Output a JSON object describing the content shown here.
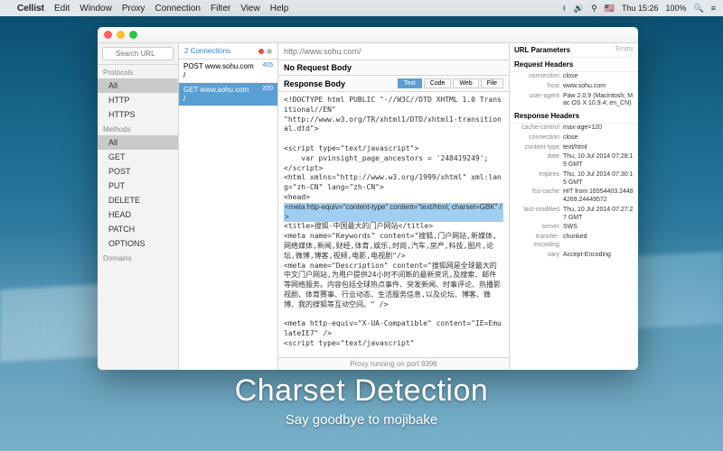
{
  "menubar": {
    "app": "Cellist",
    "items": [
      "Edit",
      "Window",
      "Proxy",
      "Connection",
      "Filter",
      "View",
      "Help"
    ],
    "clock": "Thu 15:26",
    "battery": "100%",
    "flag": "🇺🇸"
  },
  "sidebar": {
    "search_placeholder": "Search URL",
    "sections": {
      "protocols": {
        "label": "Protocols",
        "items": [
          "All",
          "HTTP",
          "HTTPS"
        ],
        "selected": 0
      },
      "methods": {
        "label": "Methods",
        "items": [
          "All",
          "GET",
          "POST",
          "PUT",
          "DELETE",
          "HEAD",
          "PATCH",
          "OPTIONS"
        ],
        "selected": 0
      },
      "domains": {
        "label": "Domains"
      }
    }
  },
  "connections": {
    "title": "2 Connections",
    "rows": [
      {
        "method": "POST",
        "host": "www.sohu.com",
        "path": "/",
        "status": "405",
        "selected": false
      },
      {
        "method": "GET",
        "host": "www.sohu.com",
        "path": "/",
        "status": "200",
        "selected": true
      }
    ]
  },
  "detail": {
    "url": "http://www.sohu.com/",
    "no_request_body": "No Request Body",
    "response_body": "Response Body",
    "tabs": [
      "Text",
      "Code",
      "Web",
      "File"
    ],
    "selected_tab": 0,
    "html_lines": [
      "<!DOCTYPE html PUBLIC \"-//W3C//DTD XHTML 1.0 Transitional//EN\"",
      "\"http://www.w3.org/TR/xhtml1/DTD/xhtml1-transitional.dtd\">",
      "",
      "<script type=\"text/javascript\">",
      "    var pvinsight_page_ancestors = '248419249';",
      "</​script>",
      "<html xmlns=\"http://www.w3.org/1999/xhtml\" xml:lang=\"zh-CN\" lang=\"zh-CN\">",
      "<head>"
    ],
    "html_highlight": "<meta http-equiv=\"content-type\" content=\"text/html; charset=GBK\" />",
    "html_after": [
      "<title>搜狐-中国最大的门户网站</title>",
      "<meta name=\"Keywords\" content=\"搜狐,门户网站,新媒体,网络媒体,新闻,财经,体育,娱乐,时尚,汽车,房产,科技,图片,论坛,微博,博客,视频,电影,电视剧\"/>",
      "<meta name=\"Description\" content=\"搜狐网是全球最大的中文门户网站,为用户提供24小时不间断的最新资讯,及搜索、邮件等网络服务。内容包括全球热点事件、突发新闻、时事评论、热播影视剧、体育赛事、行业动态、生活服务信息,以及论坛、博客、微博、我的搜狐等互动空间。\" />",
      "",
      "<meta http-equiv=\"X-UA-Compatible\" content=\"IE=EmulateIE7\" />",
      "<script type=\"text/javascript\""
    ],
    "statusbar": "Proxy running on port 9396"
  },
  "rpanel": {
    "url_params": "URL Parameters",
    "empty": "Empty",
    "req_headers": "Request Headers",
    "req_kv": [
      {
        "k": "connection",
        "v": "close"
      },
      {
        "k": "host",
        "v": "www.sohu.com"
      },
      {
        "k": "user-agent",
        "v": "Paw 2.0.9 (Macintosh; Mac OS X 10.9.4; en_CN)"
      }
    ],
    "res_headers": "Response Headers",
    "res_kv": [
      {
        "k": "cache-control",
        "v": "max-age=120"
      },
      {
        "k": "connection",
        "v": "close"
      },
      {
        "k": "content-type",
        "v": "text/html"
      },
      {
        "k": "date",
        "v": "Thu, 10 Jul 2014 07:28:15 GMT"
      },
      {
        "k": "expires",
        "v": "Thu, 10 Jul 2014 07:30:15 GMT"
      },
      {
        "k": "fss-cache",
        "v": "HIT from 16554403.24484269.24449572"
      },
      {
        "k": "last-modified",
        "v": "Thu, 10 Jul 2014 07:27:27 GMT"
      },
      {
        "k": "server",
        "v": "SWS"
      },
      {
        "k": "transfer-encoding",
        "v": "chunked"
      },
      {
        "k": "vary",
        "v": "Accept-Encoding"
      }
    ]
  },
  "marketing": {
    "headline": "Charset Detection",
    "sub": "Say goodbye to mojibake"
  }
}
